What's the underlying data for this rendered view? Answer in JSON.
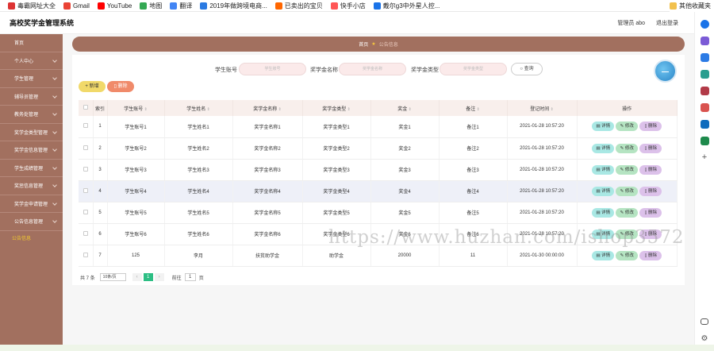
{
  "bookmarks": [
    {
      "label": "毒霸网址大全",
      "color": "#d33"
    },
    {
      "label": "Gmail",
      "color": "#ea4335"
    },
    {
      "label": "YouTube",
      "color": "#f00"
    },
    {
      "label": "地图",
      "color": "#34a853"
    },
    {
      "label": "翻译",
      "color": "#4285f4"
    },
    {
      "label": "2019年做跨境电商...",
      "color": "#2a7ae2"
    },
    {
      "label": "已卖出的宝贝",
      "color": "#f60"
    },
    {
      "label": "快手小店",
      "color": "#f55"
    },
    {
      "label": "戴尔g3中外星人控...",
      "color": "#1a73e8"
    }
  ],
  "other_bookmarks": "其他收藏夹",
  "header": {
    "title": "高校奖学金管理系统",
    "user": "管理员 abo",
    "logout": "退出登录"
  },
  "sidebar": {
    "items": [
      {
        "label": "首页",
        "arrow": false
      },
      {
        "label": "个人中心",
        "arrow": true
      },
      {
        "label": "学生管理",
        "arrow": true
      },
      {
        "label": "辅导员管理",
        "arrow": true
      },
      {
        "label": "教务处管理",
        "arrow": true
      },
      {
        "label": "奖学金类型管理",
        "arrow": true
      },
      {
        "label": "奖学金信息管理",
        "arrow": true
      },
      {
        "label": "学生成绩管理",
        "arrow": true
      },
      {
        "label": "奖惩信息管理",
        "arrow": true
      },
      {
        "label": "奖学金申请管理",
        "arrow": true
      },
      {
        "label": "公告信息管理",
        "arrow": true
      }
    ],
    "sub_item": "公告信息"
  },
  "breadcrumb": {
    "home": "首页",
    "current": "公告信息"
  },
  "search": {
    "student_label": "学生账号",
    "student_placeholder": "学生账号",
    "name_label": "奖学金名称",
    "name_placeholder": "奖学金名称",
    "type_label": "奖学金类型",
    "type_placeholder": "奖学金类型",
    "query": "查询"
  },
  "actions": {
    "add": "+ 新增",
    "delete": "删除"
  },
  "table": {
    "columns": [
      "索引",
      "学生账号",
      "学生姓名",
      "奖学金名称",
      "奖学金类型",
      "奖金",
      "备注",
      "登记时间",
      "操作"
    ],
    "rows": [
      [
        "1",
        "学生账号1",
        "学生姓名1",
        "奖学金名称1",
        "奖学金类型1",
        "奖金1",
        "备注1",
        "2021-01-28 10:57:20"
      ],
      [
        "2",
        "学生账号2",
        "学生姓名2",
        "奖学金名称2",
        "奖学金类型2",
        "奖金2",
        "备注2",
        "2021-01-28 10:57:20"
      ],
      [
        "3",
        "学生账号3",
        "学生姓名3",
        "奖学金名称3",
        "奖学金类型3",
        "奖金3",
        "备注3",
        "2021-01-28 10:57:20"
      ],
      [
        "4",
        "学生账号4",
        "学生姓名4",
        "奖学金名称4",
        "奖学金类型4",
        "奖金4",
        "备注4",
        "2021-01-28 10:57:20"
      ],
      [
        "5",
        "学生账号5",
        "学生姓名5",
        "奖学金名称5",
        "奖学金类型5",
        "奖金5",
        "备注5",
        "2021-01-28 10:57:20"
      ],
      [
        "6",
        "学生账号6",
        "学生姓名6",
        "奖学金名称6",
        "奖学金类型6",
        "奖金6",
        "备注6",
        "2021-01-28 10:57:20"
      ],
      [
        "7",
        "125",
        "李月",
        "扶贫助学金",
        "助学金",
        "20000",
        "11",
        "2021-01-30 00:00:00"
      ]
    ],
    "row_actions": {
      "detail": "详情",
      "edit": "修改",
      "remove": "删除"
    }
  },
  "pager": {
    "total": "共 7 条",
    "page_size": "10条/页",
    "current": "1",
    "goto_label": "前往",
    "goto_value": "1",
    "page_suffix": "页",
    "prev": "‹",
    "next": "›"
  },
  "watermark": "https://www.huzhan.com/ishop3572"
}
